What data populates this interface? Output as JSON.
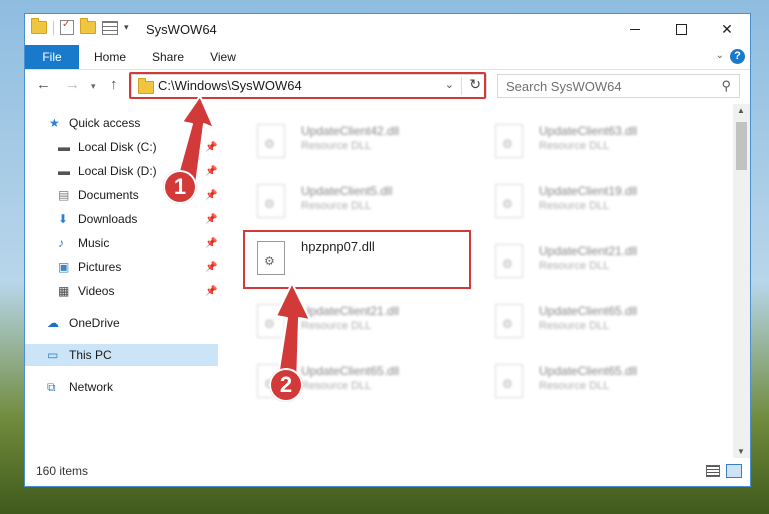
{
  "window": {
    "title": "SysWOW64",
    "min_label": "",
    "max_label": "",
    "close_label": "✕"
  },
  "ribbon": {
    "tabs": [
      "File",
      "Home",
      "Share",
      "View"
    ],
    "help": "?"
  },
  "address": {
    "path": "C:\\Windows\\SysWOW64",
    "search_placeholder": "Search SysWOW64"
  },
  "nav_pane": {
    "items": [
      {
        "label": "Quick access",
        "icon": "star-icon"
      },
      {
        "label": "Local Disk (C:)",
        "icon": "drive-icon",
        "pinned": true
      },
      {
        "label": "Local Disk (D:)",
        "icon": "drive-icon",
        "pinned": true
      },
      {
        "label": "Documents",
        "icon": "documents-icon",
        "pinned": true
      },
      {
        "label": "Downloads",
        "icon": "download-icon",
        "pinned": true
      },
      {
        "label": "Music",
        "icon": "music-icon",
        "pinned": true
      },
      {
        "label": "Pictures",
        "icon": "pictures-icon",
        "pinned": true
      },
      {
        "label": "Videos",
        "icon": "videos-icon",
        "pinned": true
      },
      {
        "label": "OneDrive",
        "icon": "cloud-icon"
      },
      {
        "label": "This PC",
        "icon": "computer-icon",
        "selected": true
      },
      {
        "label": "Network",
        "icon": "network-icon"
      }
    ]
  },
  "files": [
    {
      "name": "UpdateClient42.dll",
      "type": "Resource DLL"
    },
    {
      "name": "UpdateClient63.dll",
      "type": "Resource DLL"
    },
    {
      "name": "UpdateClient5.dll",
      "type": "Resource DLL"
    },
    {
      "name": "UpdateClient19.dll",
      "type": "Resource DLL"
    },
    {
      "name": "hpzpnp07.dll",
      "type": ""
    },
    {
      "name": "UpdateClient21.dll",
      "type": "Resource DLL"
    },
    {
      "name": "UpdateClient21.dll",
      "type": "Resource DLL"
    },
    {
      "name": "UpdateClient65.dll",
      "type": "Resource DLL"
    },
    {
      "name": "UpdateClient65.dll",
      "type": "Resource DLL"
    },
    {
      "name": "UpdateClient65.dll",
      "type": "Resource DLL"
    }
  ],
  "status": {
    "item_count": "160 items"
  },
  "annotations": {
    "step1": "1",
    "step2": "2",
    "color": "#d23a3a"
  }
}
